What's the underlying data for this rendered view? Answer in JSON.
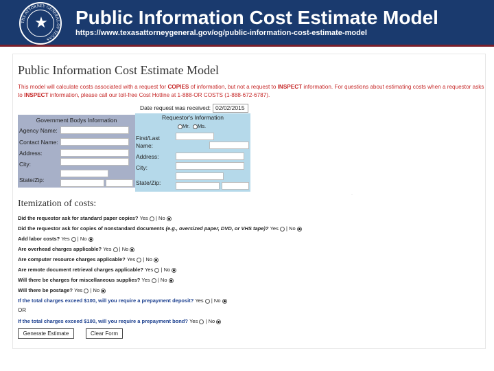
{
  "header": {
    "title": "Public Information Cost Estimate Model",
    "url": "https://www.texasattorneygeneral.gov/og/public-information-cost-estimate-model",
    "seal_text": "THE ATTORNEY GENERAL OF TEXAS",
    "bg_color": "#1a3a6e",
    "accent_color": "#7a1f2b"
  },
  "form": {
    "title": "Public Information Cost Estimate Model",
    "intro": {
      "p1": "This model will calculate costs associated with a request for ",
      "copies": "COPIES",
      "p2": " of information, but not a request to ",
      "inspect": "INSPECT",
      "p3": " information. For questions about estimating costs when a requestor asks to ",
      "inspect2": "INSPECT",
      "p4": " information, please call our toll-free Cost Hotline at 1-888-OR COSTS (1-888-672-6787)."
    },
    "date_label": "Date request was received:",
    "date_value": "02/02/2015",
    "gov_box": {
      "heading": "Government Bodys Information",
      "agency_label": "Agency Name:",
      "contact_label": "Contact Name:",
      "address_label": "Address:",
      "city_label": "City:",
      "state_zip_label": "State/Zip:"
    },
    "req_box": {
      "heading": "Requestor's Information",
      "mr_label": "Mr.",
      "ms_label": "Ms.",
      "first_last_label": "First/Last",
      "name_label": "Name:",
      "address_label": "Address:",
      "city_label": "City:",
      "state_zip_label": "State/Zip:"
    },
    "itemization_heading": "Itemization of costs:",
    "yes_label": "Yes",
    "no_label": "No",
    "questions": [
      {
        "text": "Did the requestor ask for standard paper copies?",
        "answer": "No"
      },
      {
        "text_a": "Did the requestor ask for copies of nonstandard documents ",
        "text_b": "(e.g., oversized paper, DVD, or VHS tape)?",
        "answer": "No"
      },
      {
        "text": "Add labor costs?",
        "answer": "No"
      },
      {
        "text": "Are overhead charges applicable?",
        "answer": "No"
      },
      {
        "text": "Are computer resource charges applicable?",
        "answer": "No"
      },
      {
        "text": "Are remote document retrieval charges applicable?",
        "answer": "No"
      },
      {
        "text": "Will there be charges for miscellaneous supplies?",
        "answer": "No"
      },
      {
        "text": "Will there be postage?",
        "answer": "No"
      },
      {
        "text": "If the total charges exceed $100, will you require a prepayment deposit?",
        "answer": "No"
      },
      {
        "text": "If the total charges exceed $100, will you require a prepayment bond?",
        "answer": "No"
      }
    ],
    "or_label": "OR",
    "generate_button": "Generate Estimate",
    "clear_button": "Clear Form"
  }
}
